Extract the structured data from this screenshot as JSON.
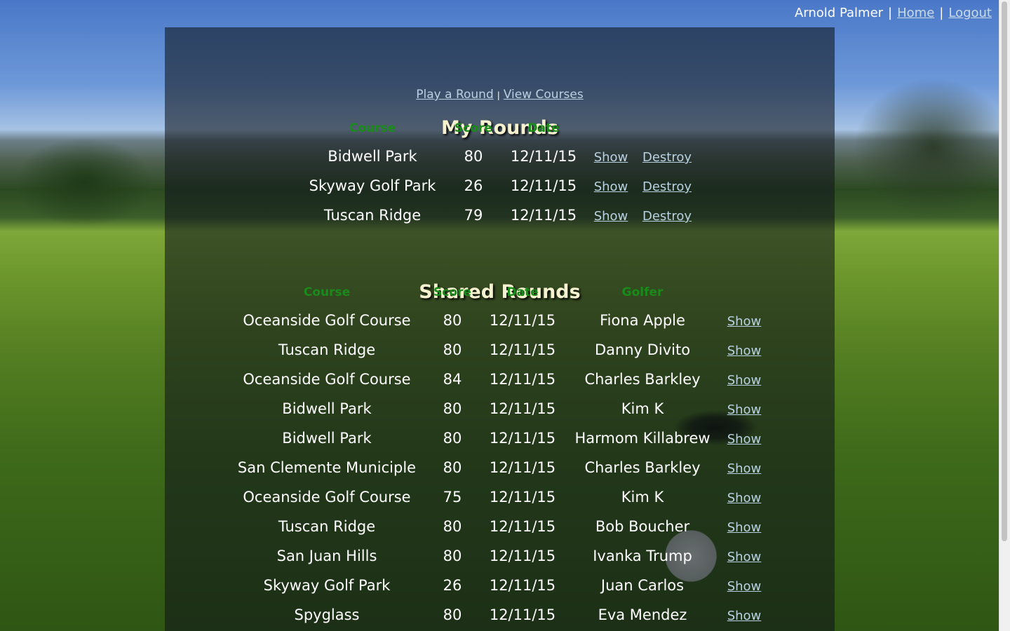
{
  "header": {
    "user_name": "Arnold Palmer",
    "separator": "|",
    "home_label": "Home",
    "logout_label": "Logout"
  },
  "nav": {
    "play_label": "Play a Round",
    "separator": "|",
    "courses_label": "View Courses"
  },
  "my_rounds": {
    "title": "My Rounds",
    "columns": [
      "Course",
      "Score",
      "Date"
    ],
    "show_label": "Show",
    "destroy_label": "Destroy",
    "rows": [
      {
        "course": "Bidwell Park",
        "score": "80",
        "date": "12/11/15"
      },
      {
        "course": "Skyway Golf Park",
        "score": "26",
        "date": "12/11/15"
      },
      {
        "course": "Tuscan Ridge",
        "score": "79",
        "date": "12/11/15"
      }
    ]
  },
  "shared_rounds": {
    "title": "Shared Rounds",
    "columns": [
      "Course",
      "Score",
      "Date",
      "Golfer"
    ],
    "show_label": "Show",
    "rows": [
      {
        "course": "Oceanside Golf Course",
        "score": "80",
        "date": "12/11/15",
        "golfer": "Fiona Apple"
      },
      {
        "course": "Tuscan Ridge",
        "score": "80",
        "date": "12/11/15",
        "golfer": "Danny Divito"
      },
      {
        "course": "Oceanside Golf Course",
        "score": "84",
        "date": "12/11/15",
        "golfer": "Charles Barkley"
      },
      {
        "course": "Bidwell Park",
        "score": "80",
        "date": "12/11/15",
        "golfer": "Kim K"
      },
      {
        "course": "Bidwell Park",
        "score": "80",
        "date": "12/11/15",
        "golfer": "Harmom Killabrew"
      },
      {
        "course": "San Clemente Municiple",
        "score": "80",
        "date": "12/11/15",
        "golfer": "Charles Barkley"
      },
      {
        "course": "Oceanside Golf Course",
        "score": "75",
        "date": "12/11/15",
        "golfer": "Kim K"
      },
      {
        "course": "Tuscan Ridge",
        "score": "80",
        "date": "12/11/15",
        "golfer": "Bob Boucher"
      },
      {
        "course": "San Juan Hills",
        "score": "80",
        "date": "12/11/15",
        "golfer": "Ivanka Trump"
      },
      {
        "course": "Skyway Golf Park",
        "score": "26",
        "date": "12/11/15",
        "golfer": "Juan Carlos"
      },
      {
        "course": "Spyglass",
        "score": "80",
        "date": "12/11/15",
        "golfer": "Eva Mendez"
      }
    ]
  }
}
